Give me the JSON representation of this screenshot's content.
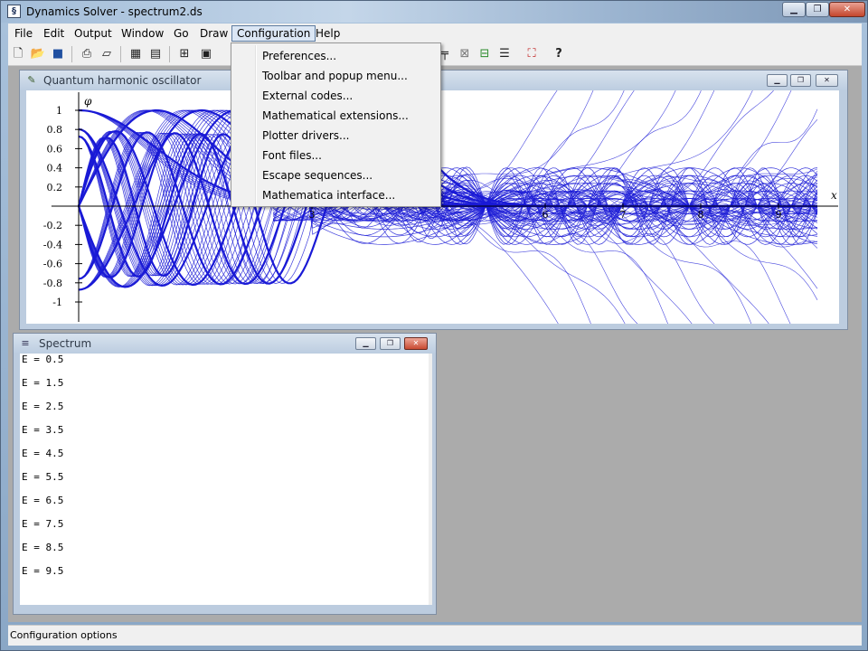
{
  "window": {
    "title": "Dynamics Solver - spectrum2.ds",
    "app_icon": "dynamics-solver-icon"
  },
  "caption_buttons": [
    "minimize",
    "maximize",
    "close"
  ],
  "menubar": [
    "File",
    "Edit",
    "Output",
    "Window",
    "Go",
    "Draw",
    "Configuration",
    "Help"
  ],
  "toolbar": {
    "icons": [
      "new-file-icon",
      "open-folder-icon",
      "save-icon",
      "print-icon",
      "print-preview-icon",
      "table-icon",
      "table-edit-icon",
      "zoom-box-icon",
      "window-icon"
    ],
    "right_icons": [
      "draw-lines-icon",
      "solve-icon",
      "export-icon",
      "split-icon",
      "fit-window-icon",
      "help-icon"
    ],
    "help_glyph": "?"
  },
  "configuration_menu": {
    "open": true,
    "items": [
      "Preferences...",
      "Toolbar and popup menu...",
      "External codes...",
      "Mathematical extensions...",
      "Plotter drivers...",
      "Font files...",
      "Escape sequences...",
      "Mathematica interface..."
    ]
  },
  "plot_window": {
    "title": "Quantum harmonic oscillator",
    "axis_labels": {
      "y": "φ",
      "x": "x"
    },
    "y_ticks": [
      "1",
      "0.8",
      "0.6",
      "0.4",
      "0.2",
      "-0.2",
      "-0.4",
      "-0.6",
      "-0.8",
      "-1"
    ],
    "x_ticks": [
      "3",
      "6",
      "7",
      "8",
      "9"
    ],
    "curve_color": "#1a1ad6"
  },
  "spectrum_window": {
    "title": "Spectrum",
    "lines": [
      "E = 0.5",
      "E = 1.5",
      "E = 2.5",
      "E = 3.5",
      "E = 4.5",
      "E = 5.5",
      "E = 6.5",
      "E = 7.5",
      "E = 8.5",
      "E = 9.5"
    ]
  },
  "statusbar": {
    "text": "Configuration options"
  }
}
